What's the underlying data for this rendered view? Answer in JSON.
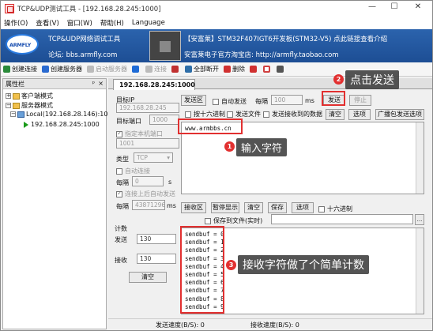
{
  "window": {
    "title": "TCP&UDP测试工具 - [192.168.28.245:1000]",
    "min": "—",
    "max": "☐",
    "close": "✕"
  },
  "menu": [
    "操作(O)",
    "查看(V)",
    "窗口(W)",
    "帮助(H)",
    "Language"
  ],
  "banner": {
    "logo": "ARMFLY",
    "line1": "TCP&UDP网络调试工具",
    "line2": "论坛: bbs.armfly.com",
    "line3": "【安富莱】STM32F407IGT6开发板(STM32-V5) 点此链接查看介绍",
    "line4": "安富莱电子官方淘宝店: http://armfly.taobao.com"
  },
  "toolbar": [
    {
      "label": "创建连接",
      "color": "#2a8a3a"
    },
    {
      "label": "创建服务器",
      "color": "#2a6ad0"
    },
    {
      "label": "启动服务器",
      "color": "#999999",
      "disabled": true
    },
    {
      "label": "",
      "color": "#1e6bd6"
    },
    {
      "label": "连接",
      "color": "#999999",
      "disabled": true
    },
    {
      "label": "",
      "color": "#c03030"
    },
    {
      "label": "全部断开",
      "color": "#2e6ea8"
    },
    {
      "label": "删除",
      "color": "#d03030"
    },
    {
      "label": "",
      "color": "#d03030"
    },
    {
      "label": "",
      "color": "#d04040"
    }
  ],
  "sidebar": {
    "title": "属性栏",
    "pin": "ᵖ",
    "close": "×",
    "tree": [
      {
        "label": "客户端模式"
      },
      {
        "label": "服务器模式"
      },
      {
        "label": "Local(192.168.28.146):1001"
      },
      {
        "label": "192.168.28.245:1000"
      }
    ]
  },
  "tab": {
    "label": "192.168.28.245:1000"
  },
  "conn": {
    "target_ip_label": "目标IP",
    "target_ip": "192.168.28.245",
    "target_port_label": "目标端口",
    "target_port": "1000",
    "specify_local_port": "指定本机端口",
    "local_port": "1001",
    "type_label": "类型",
    "type": "TCP",
    "auto_connect": "自动连接",
    "every_label_1": "每隔",
    "every_value_1": "0",
    "unit_s": "s",
    "auto_send_after_connect": "连接上后自动发送",
    "every_label_2": "每隔",
    "every_value_2": "43871296",
    "unit_ms": "ms"
  },
  "counter": {
    "title": "计数",
    "send_label": "发送",
    "send_value": "130",
    "recv_label": "接收",
    "recv_value": "130",
    "clear": "清空"
  },
  "send": {
    "area_label": "发送区",
    "auto_send": "自动发送",
    "every": "每隔",
    "ms_value": "100",
    "ms": "ms",
    "send_btn": "发送",
    "stop_btn": "停止",
    "hex_16": "按十六进制",
    "send_file": "发送文件",
    "send_on_recv": "发送接收到的数据",
    "clear_btn": "清空",
    "options_btn": "选项",
    "broadcast": "广播包发送选项",
    "text": "www.armbbs.cn"
  },
  "recv": {
    "area_label": "接收区",
    "pause": "暂停显示",
    "clear": "清空",
    "save": "保存",
    "options": "选项",
    "hex16": "十六进制",
    "save_to_file": "保存到文件(实时)",
    "browse": "...",
    "lines": [
      "sendbuf = 0",
      "sendbuf = 1",
      "sendbuf = 2",
      "sendbuf = 3",
      "sendbuf = 4",
      "sendbuf = 5",
      "sendbuf = 6",
      "sendbuf = 7",
      "sendbuf = 8",
      "sendbuf = 9"
    ]
  },
  "annotations": {
    "a1": {
      "num": "1",
      "text": "输入字符"
    },
    "a2": {
      "num": "2",
      "text": "点击发送"
    },
    "a3": {
      "num": "3",
      "text": "接收字符做了个简单计数"
    }
  },
  "status": {
    "send_speed": "发送速度(B/S): 0",
    "recv_speed": "接收速度(B/S): 0"
  }
}
